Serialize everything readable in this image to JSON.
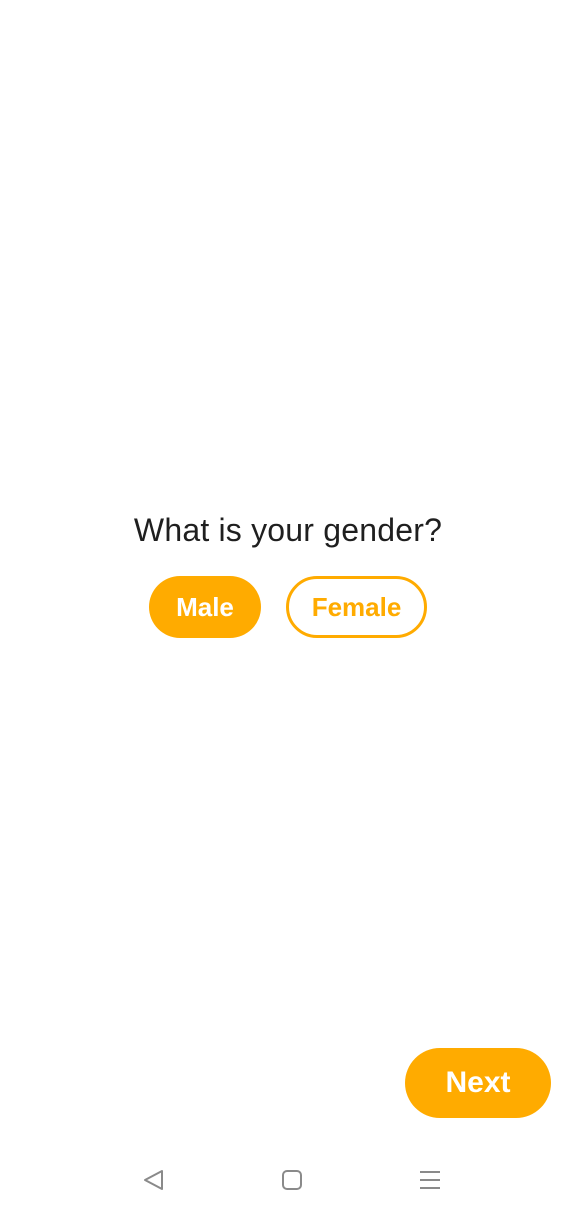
{
  "colors": {
    "accent": "#ffab00",
    "text": "#1f1f1f",
    "nav_icon": "#8a8a8a"
  },
  "gender_prompt": {
    "question": "What is your gender?",
    "options": [
      {
        "label": "Male",
        "selected": true
      },
      {
        "label": "Female",
        "selected": false
      }
    ]
  },
  "next_button": {
    "label": "Next"
  },
  "system_nav": {
    "icons": [
      "back-icon",
      "home-icon",
      "recents-icon"
    ]
  }
}
